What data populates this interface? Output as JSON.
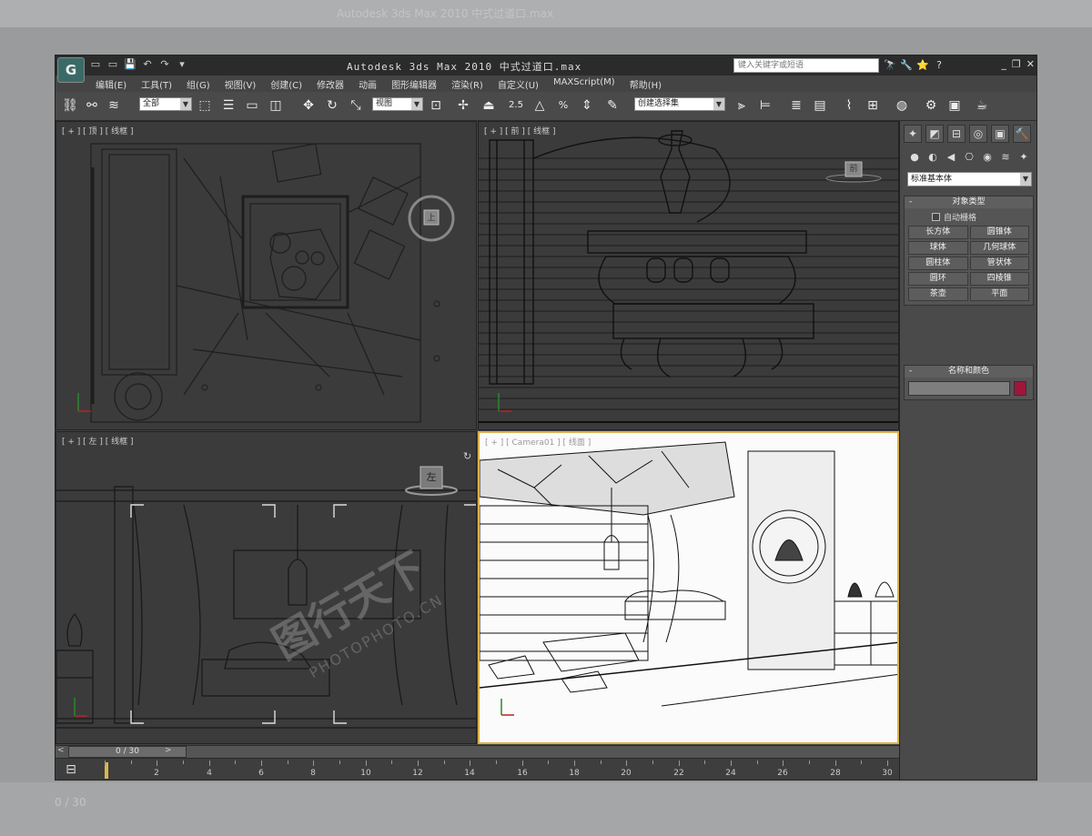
{
  "window": {
    "logo_glyph": "G",
    "title": "Autodesk 3ds Max  2010    中式过道口.max",
    "search_placeholder": "键入关键字或短语",
    "controls": [
      "_",
      "❐",
      "✕"
    ]
  },
  "quick_access": [
    "▭",
    "▭",
    "💾",
    "↶",
    "↷",
    "▾"
  ],
  "search_tools": [
    "🔭",
    "🔧",
    "⭐",
    "?"
  ],
  "menu": [
    "编辑(E)",
    "工具(T)",
    "组(G)",
    "视图(V)",
    "创建(C)",
    "修改器",
    "动画",
    "图形编辑器",
    "渲染(R)",
    "自定义(U)",
    "MAXScript(M)",
    "帮助(H)"
  ],
  "toolbar": {
    "selection_filter": "全部",
    "ref_coord": "视图",
    "named_selection": "创建选择集",
    "snap_label": "2.5",
    "percent_label": "%"
  },
  "viewports": {
    "top": {
      "label": "[ + ] [ 顶 ] [ 线框 ]",
      "nav_cube": "上"
    },
    "front": {
      "label": "[ + ] [ 前 ] [ 线框 ]",
      "nav_cube": "前"
    },
    "left": {
      "label": "[ + ] [ 左 ] [ 线框 ]",
      "nav_cube": "左"
    },
    "camera": {
      "label": "[ + ] [ Camera01 ] [ 线面 ]"
    }
  },
  "command_panel": {
    "tabs": [
      "✦",
      "◩",
      "⊟",
      "◎",
      "▣",
      "🔨"
    ],
    "sub_icons": [
      "●",
      "◐",
      "◀",
      "⎔",
      "◉",
      "≋",
      "✦"
    ],
    "category": "标准基本体",
    "object_type": {
      "header": "对象类型",
      "autogrid": "自动栅格",
      "buttons": [
        "长方体",
        "圆锥体",
        "球体",
        "几何球体",
        "圆柱体",
        "管状体",
        "圆环",
        "四棱锥",
        "茶壶",
        "平面"
      ]
    },
    "name_color": {
      "header": "名称和颜色",
      "color": "#a0163a"
    }
  },
  "timeline": {
    "frame_display": "0 / 30",
    "ticks": [
      "2",
      "4",
      "6",
      "8",
      "10",
      "12",
      "14",
      "16",
      "18",
      "20",
      "22",
      "24",
      "26",
      "28",
      "30"
    ]
  },
  "watermark": {
    "text": "图行天下",
    "sub": "PHOTOPHOTO.CN"
  }
}
